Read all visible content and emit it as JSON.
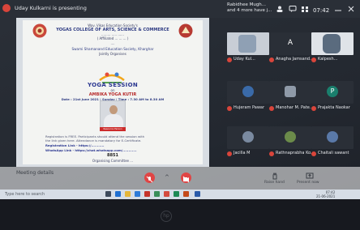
{
  "topbar": {
    "presenter": "Uday Kulkarni is presenting",
    "notice_line1": "Rabidhee Mugh...",
    "notice_line2": "and 4 more have j...",
    "clock": "07:42"
  },
  "poster": {
    "society": "Wav..Vikas Education Society's",
    "college": "YOGAS COLLEGE OF ARTS, SCIENCE & COMMERCE",
    "sub1": "......... ..... ......",
    "sub2": "( Affiliated ... ... ... )",
    "sub3": "....",
    "sub4": "Swami Shamanand Education Society, Kharghar",
    "sub5": "Jointly Organises",
    "title_word": "YOGA",
    "title_word2": "SESSION",
    "on": "on",
    "subject": "AMBIKA YOGA KUTIR",
    "date_line": "Date : 21st June 2021 | Sunday | Time : 7.30 AM to 8.30 AM",
    "speaker_caption": "Resource Person",
    "body1": "Registration is FREE. Participants should attend the session with",
    "body2": "the link given here. Attendance is mandatory for E-Certificate.",
    "body3": "Registration Link - https://...........",
    "body4": "WhatsApp Link - https://chat.whatsapp.com/............",
    "code": "8851",
    "footer": "Organising Committee ..."
  },
  "participants": [
    {
      "name": "Uday Kul...",
      "initial": "",
      "color": "#8fa0b4"
    },
    {
      "name": "Anagha Jamsand...",
      "initial": "A",
      "color": "#2f353d"
    },
    {
      "name": "Kalpesh...",
      "initial": "",
      "color": "#5a6b7e"
    },
    {
      "name": "Hujeram Pawar",
      "initial": "",
      "color": "#3a6aa8"
    },
    {
      "name": "Manohar M. Pate...",
      "initial": "",
      "color": "#8f9aa8"
    },
    {
      "name": "Prajakta Naokar",
      "initial": "P",
      "color": "#1a7f6d"
    },
    {
      "name": "Jacilla M",
      "initial": "",
      "color": "#7a8aa0"
    },
    {
      "name": "Rathnaprabha Ko...",
      "initial": "",
      "color": "#6b8b4a"
    },
    {
      "name": "Chaitali sawant",
      "initial": "",
      "color": "#5a79a8"
    }
  ],
  "controls": {
    "details": "Meeting details",
    "raise_hand": "Raise hand",
    "present_now": "Present now",
    "chevron": "^"
  },
  "taskbar": {
    "search": "Type here to search",
    "tray_time": "07:42",
    "tray_date": "21-06-2021"
  },
  "bezel": {
    "brand": "hp"
  },
  "colors": {
    "accent_red": "#e04545",
    "shared_bg": "#f3f4f2"
  }
}
